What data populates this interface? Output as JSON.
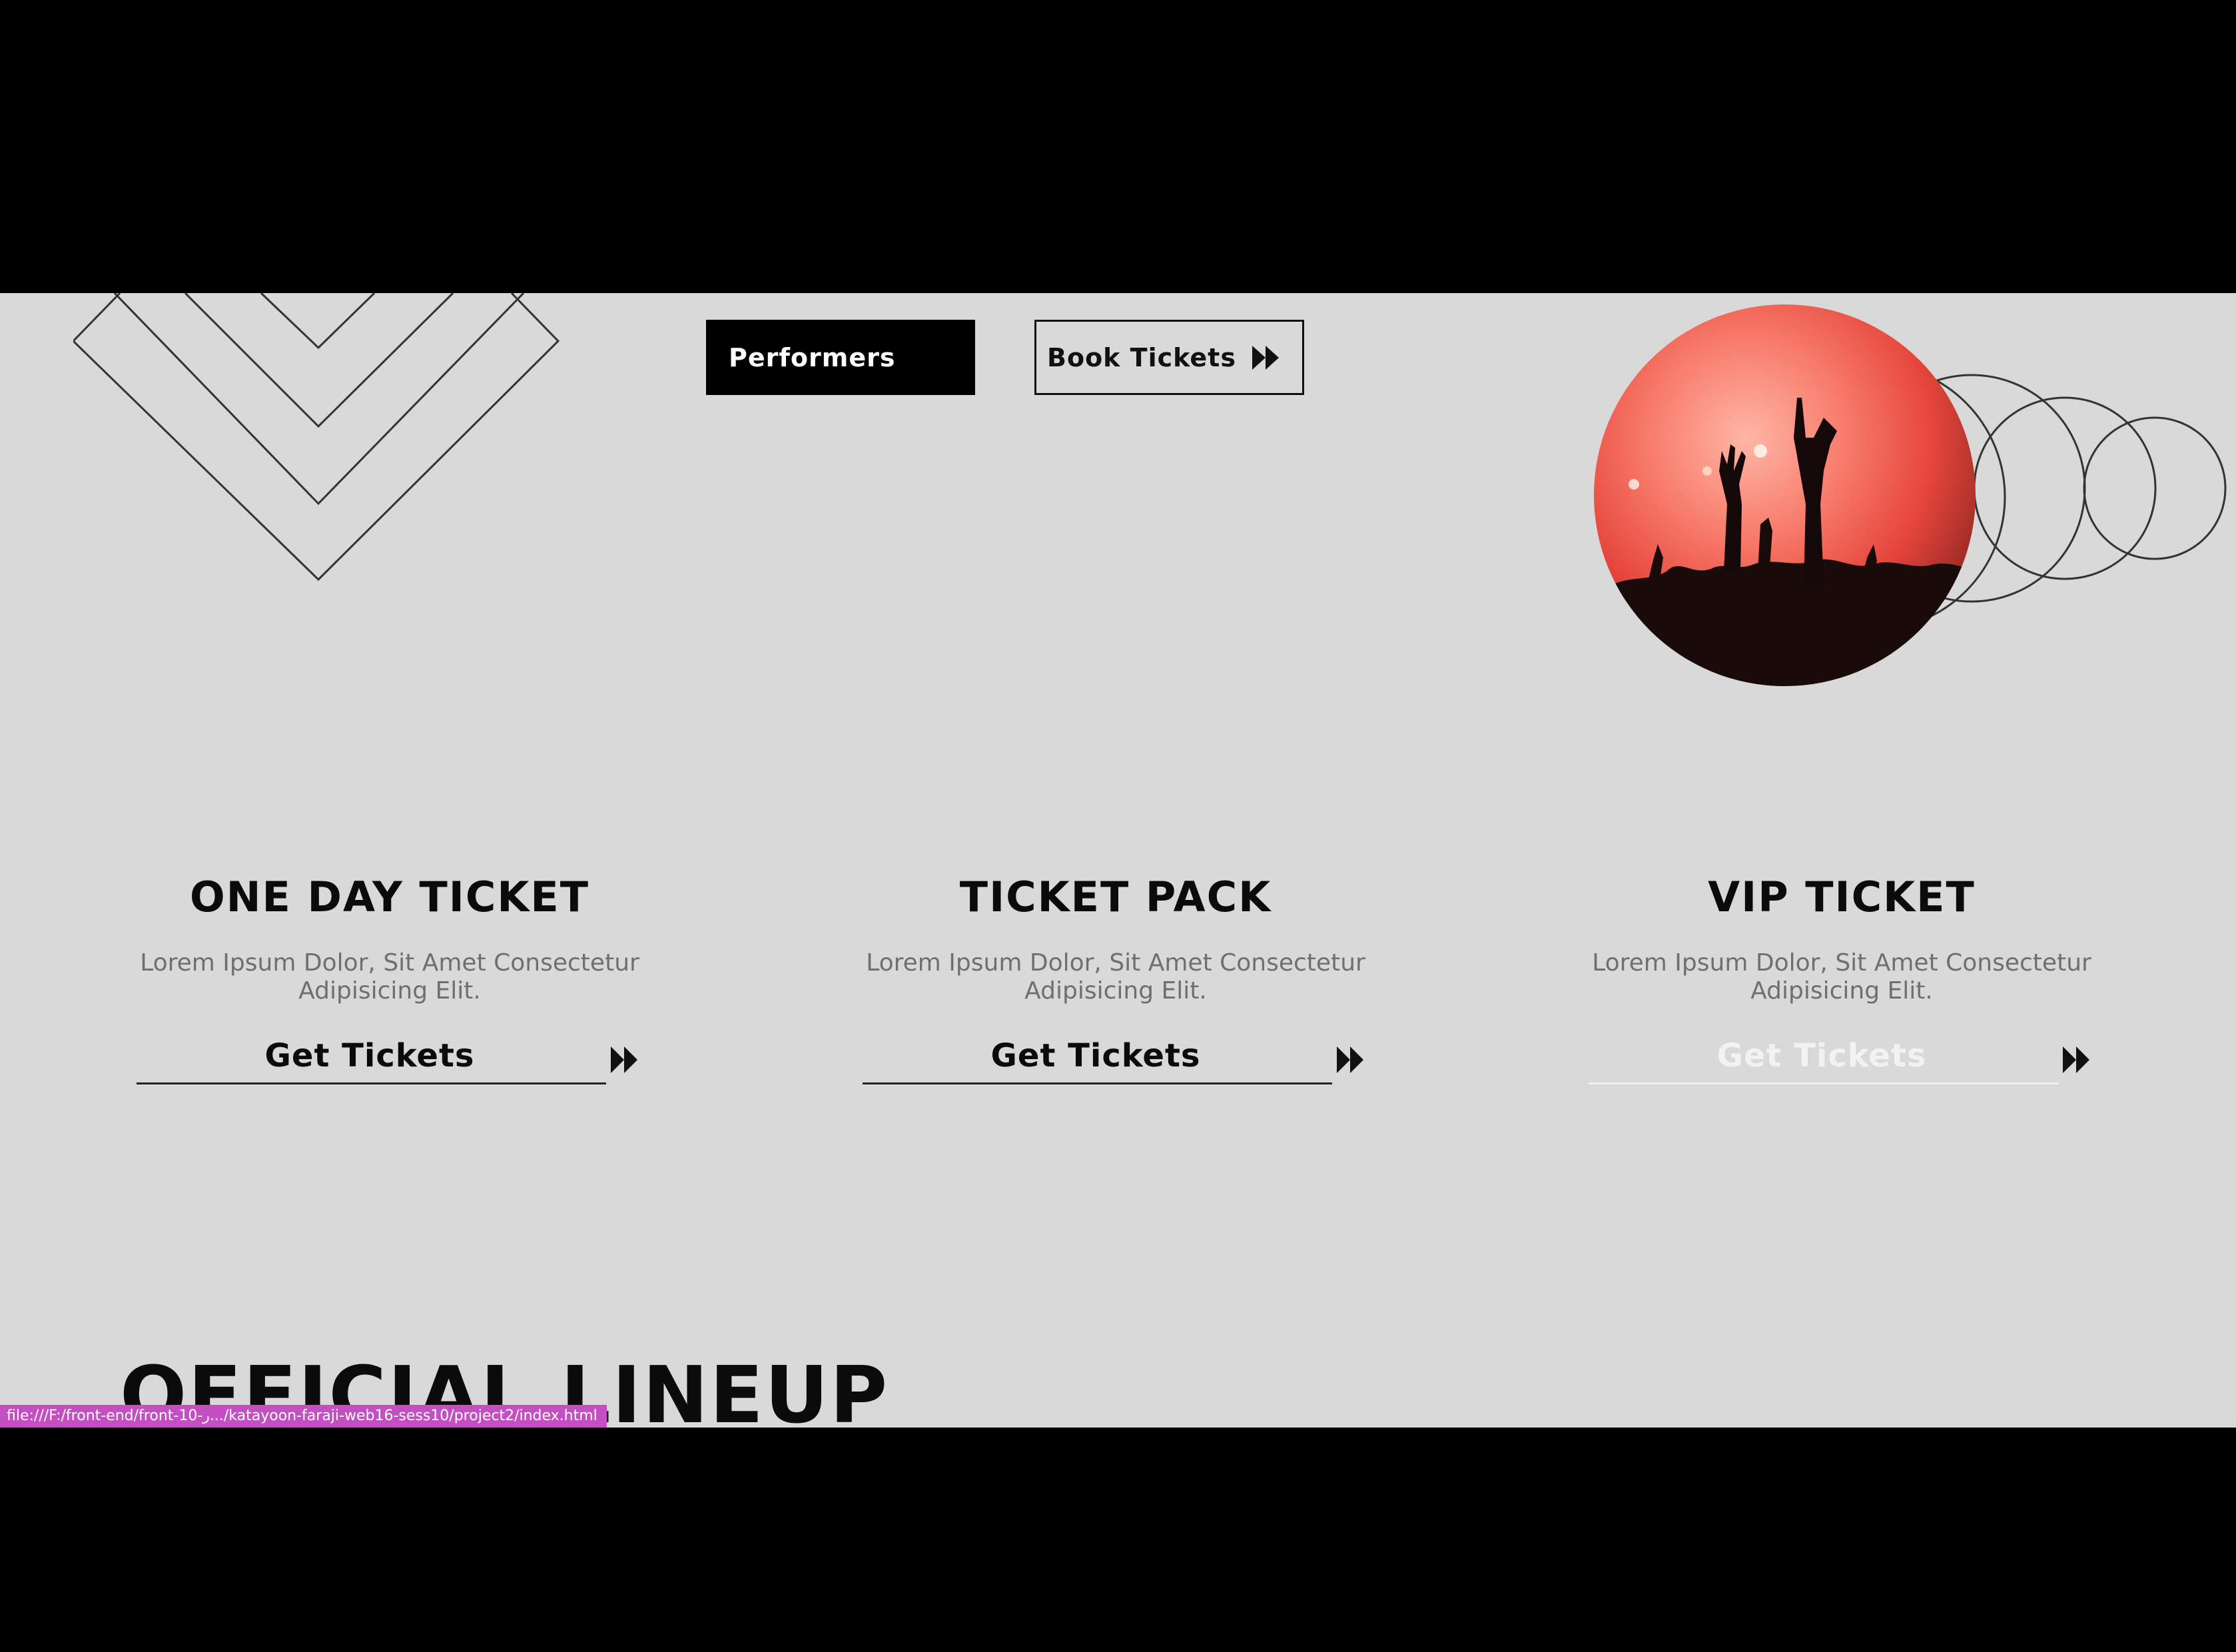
{
  "header": {
    "performers_label": "Performers",
    "book_tickets_label": "Book Tickets"
  },
  "tickets": [
    {
      "title": "ONE DAY TICKET",
      "description": "Lorem Ipsum Dolor, Sit Amet Consectetur Adipisicing Elit.",
      "cta": "Get Tickets"
    },
    {
      "title": "TICKET PACK",
      "description": "Lorem Ipsum Dolor, Sit Amet Consectetur Adipisicing Elit.",
      "cta": "Get Tickets"
    },
    {
      "title": "VIP TICKET",
      "description": "Lorem Ipsum Dolor, Sit Amet Consectetur Adipisicing Elit.",
      "cta": "Get Tickets"
    }
  ],
  "lineup": {
    "title": "OFFICIAL LINEUP"
  },
  "status_bar": {
    "url": "file:///F:/front-end/front-10-ر.../katayoon-faraji-web16-sess10/project2/index.html"
  },
  "icons": {
    "arrow": "double-chevron-right-icon",
    "decor_left": "chevron-lines-decoration",
    "decor_right": "concentric-circles-decoration",
    "photo": "concert-crowd-photo"
  },
  "colors": {
    "page_bg": "#d9d9d9",
    "text_dark": "#0b0b0b",
    "text_muted": "#6f6f6f",
    "status_bar": "#c34fc2",
    "letterbox": "#000000"
  }
}
